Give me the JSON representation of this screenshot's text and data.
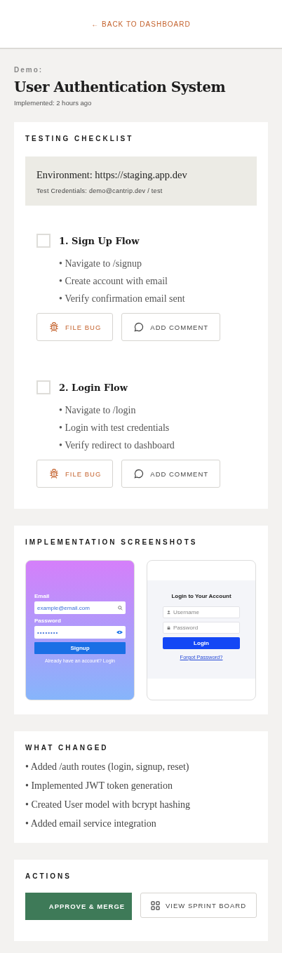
{
  "back_link": "← BACK TO DASHBOARD",
  "eyebrow": "Demo:",
  "title": "User Authentication System",
  "meta": "Implemented: 2 hours ago",
  "checklist": {
    "heading": "TESTING CHECKLIST",
    "environment": "Environment: https://staging.app.dev",
    "credentials": "Test Credentials: demo@cantrip.dev / test",
    "items": [
      {
        "title": "1. Sign Up Flow",
        "checked": false,
        "steps": [
          "• Navigate to /signup",
          "• Create account with email",
          "• Verify confirmation email sent"
        ],
        "actions": [
          {
            "kind": "bug",
            "label": "FILE BUG"
          },
          {
            "kind": "comment",
            "label": "ADD COMMENT"
          }
        ]
      },
      {
        "title": "2. Login Flow",
        "checked": false,
        "steps": [
          "• Navigate to /login",
          "• Login with test credentials",
          "• Verify redirect to dashboard"
        ],
        "actions": [
          {
            "kind": "bug",
            "label": "FILE BUG"
          },
          {
            "kind": "comment",
            "label": "ADD COMMENT"
          }
        ]
      }
    ]
  },
  "screenshots": {
    "heading": "IMPLEMENTATION SCREENSHOTS",
    "items": [
      {
        "kind": "signup",
        "email_label": "Email",
        "email_value": "example@email.com",
        "password_label": "Password",
        "password_value": "••••••••",
        "button": "Signup",
        "footer": "Already have an account? Login"
      },
      {
        "kind": "login",
        "title": "Login to Your Account",
        "username_placeholder": "Username",
        "password_placeholder": "Password",
        "button": "Login",
        "link": "Forgot Password?"
      }
    ]
  },
  "changes": {
    "heading": "WHAT CHANGED",
    "items": [
      "• Added /auth routes (login, signup, reset)",
      "• Implemented JWT token generation",
      "• Created User model with bcrypt hashing",
      "• Added email service integration"
    ]
  },
  "actions": {
    "heading": "ACTIONS",
    "buttons": [
      {
        "kind": "primary",
        "label": "APPROVE & MERGE"
      },
      {
        "kind": "board",
        "label": "VIEW SPRINT BOARD"
      }
    ]
  }
}
